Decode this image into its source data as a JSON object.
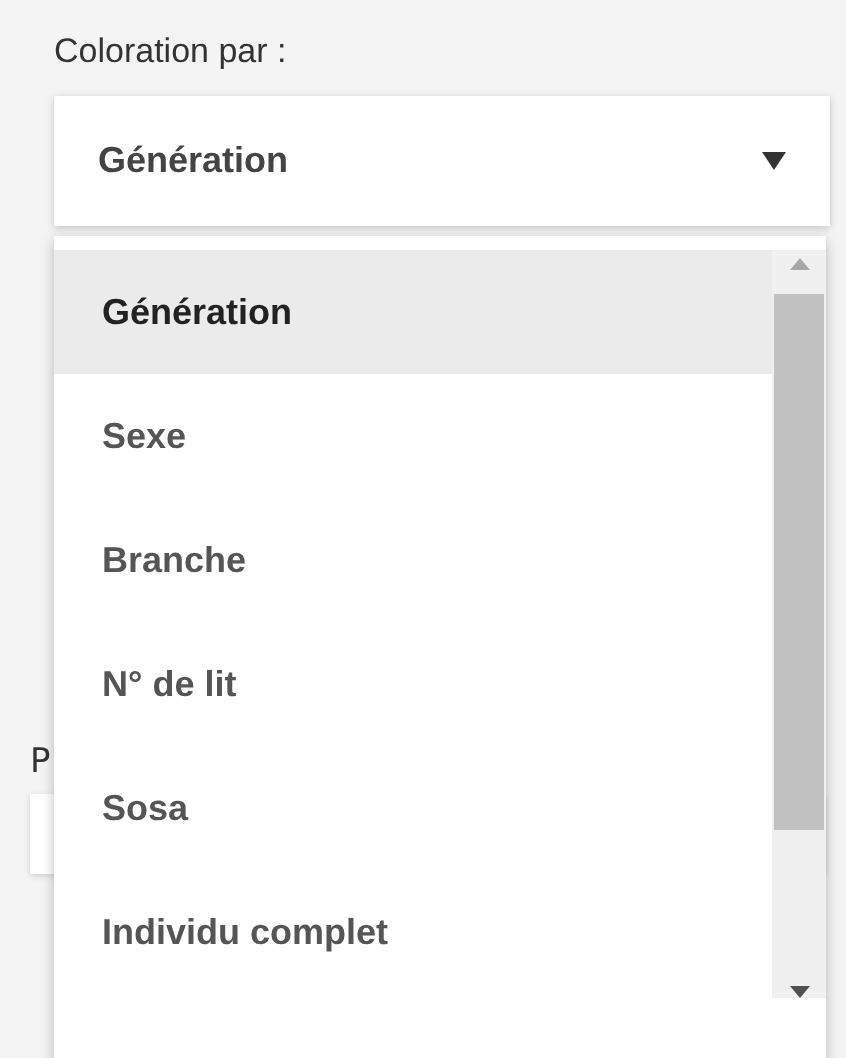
{
  "coloring": {
    "label": "Coloration par :",
    "value": "Génération",
    "expanded": true,
    "options": [
      {
        "label": "Génération",
        "selected": true
      },
      {
        "label": "Sexe",
        "selected": false
      },
      {
        "label": "Branche",
        "selected": false
      },
      {
        "label": "N° de lit",
        "selected": false
      },
      {
        "label": "Sosa",
        "selected": false
      },
      {
        "label": "Individu complet",
        "selected": false
      }
    ]
  },
  "behind_field": {
    "label": "P"
  }
}
